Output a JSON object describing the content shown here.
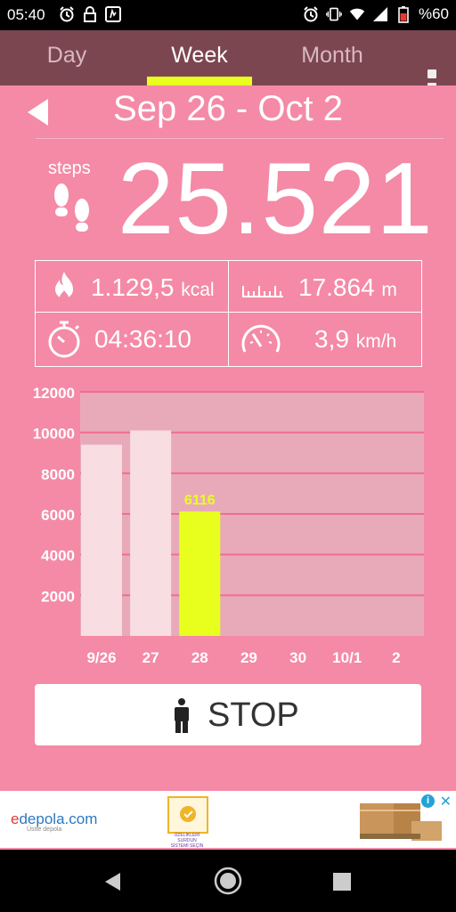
{
  "status_bar": {
    "time": "05:40",
    "battery": "%60",
    "icons": [
      "alarm-icon",
      "lock-icon",
      "notification-icon",
      "alarm-icon",
      "vibrate-icon",
      "wifi-icon",
      "signal-icon",
      "battery-icon"
    ]
  },
  "tabs": [
    {
      "label": "Day",
      "active": false
    },
    {
      "label": "Week",
      "active": true
    },
    {
      "label": "Month",
      "active": false
    }
  ],
  "header": {
    "date_range": "Sep 26 - Oct 2"
  },
  "steps": {
    "label": "steps",
    "value": "25.521"
  },
  "stats": {
    "calories": {
      "value": "1.129,5",
      "unit": "kcal"
    },
    "distance": {
      "value": "17.864",
      "unit": "m"
    },
    "duration": {
      "value": "04:36:10"
    },
    "speed": {
      "value": "3,9",
      "unit": "km/h"
    }
  },
  "chart_data": {
    "type": "bar",
    "categories": [
      "9/26",
      "27",
      "28",
      "29",
      "30",
      "10/1",
      "2"
    ],
    "values": [
      9400,
      10100,
      6116,
      null,
      null,
      null,
      null
    ],
    "ylim": [
      0,
      12000
    ],
    "yticks": [
      2000,
      4000,
      6000,
      8000,
      10000,
      12000
    ],
    "highlighted_index": 2,
    "highlighted_label": "6116",
    "grid": true,
    "colors": {
      "bar": "#f8dde3",
      "highlight": "#e8ff1e",
      "plot_bg": "#e8aab9",
      "gridline": "#f06d8f"
    }
  },
  "stop_button": {
    "label": "STOP"
  },
  "ad": {
    "brand_main": "depola.com",
    "brand_prefix": "e",
    "tagline": "Üstte depola",
    "mid_text": "ÜZELİKLERİ SURDUN SİSTEMİ SEÇİN"
  },
  "colors": {
    "accent": "#e8ff1e",
    "background": "#f48aa6",
    "tabbar": "#7c4651"
  }
}
